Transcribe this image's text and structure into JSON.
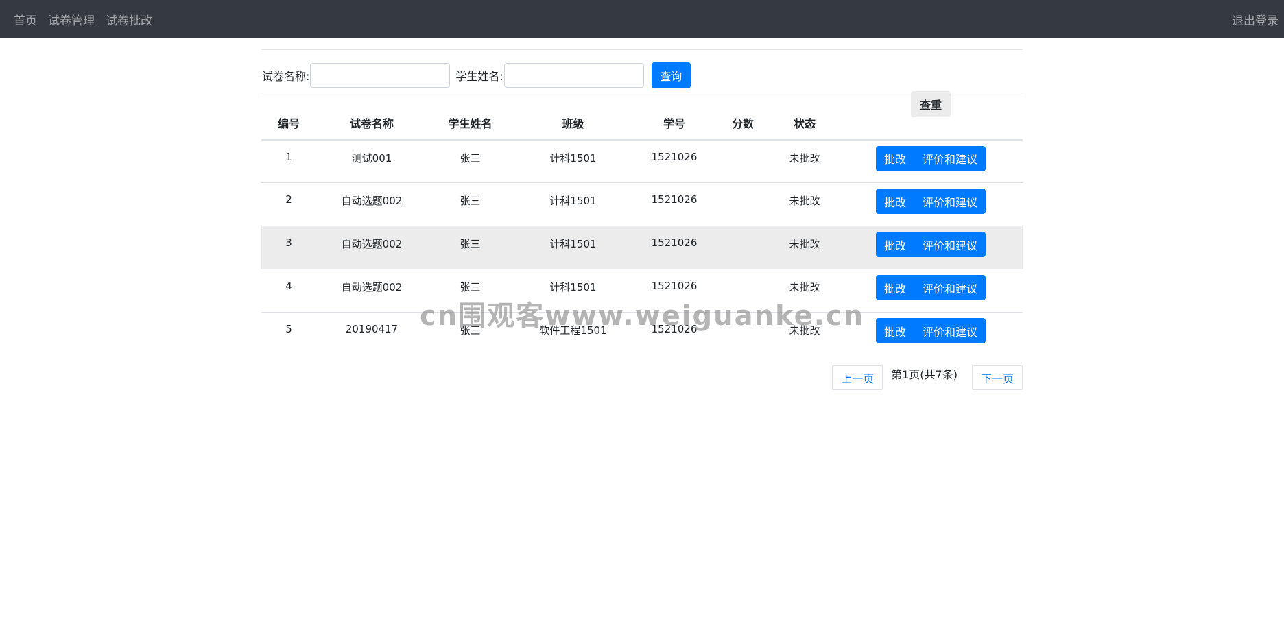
{
  "nav": {
    "items": [
      "首页",
      "试卷管理",
      "试卷批改"
    ],
    "logout": "退出登录"
  },
  "search": {
    "paper_label": "试卷名称:",
    "paper_value": "",
    "student_label": "学生姓名:",
    "student_value": "",
    "query_button": "查询"
  },
  "table": {
    "headers": [
      "编号",
      "试卷名称",
      "学生姓名",
      "班级",
      "学号",
      "分数",
      "状态"
    ],
    "recheck_button": "查重",
    "action_grade": "批改",
    "action_review": "评价和建议",
    "rows": [
      {
        "id": "1",
        "paper": "测试001",
        "student": "张三",
        "class": "计科1501",
        "sid": "1521026",
        "score": "",
        "status": "未批改"
      },
      {
        "id": "2",
        "paper": "自动选题002",
        "student": "张三",
        "class": "计科1501",
        "sid": "1521026",
        "score": "",
        "status": "未批改"
      },
      {
        "id": "3",
        "paper": "自动选题002",
        "student": "张三",
        "class": "计科1501",
        "sid": "1521026",
        "score": "",
        "status": "未批改"
      },
      {
        "id": "4",
        "paper": "自动选题002",
        "student": "张三",
        "class": "计科1501",
        "sid": "1521026",
        "score": "",
        "status": "未批改"
      },
      {
        "id": "5",
        "paper": "20190417",
        "student": "张三",
        "class": "软件工程1501",
        "sid": "1521026",
        "score": "",
        "status": "未批改"
      }
    ]
  },
  "pagination": {
    "prev": "上一页",
    "info": "第1页(共7条)",
    "next": "下一页"
  },
  "watermark": "cn围观客www.weiguanke.cn"
}
